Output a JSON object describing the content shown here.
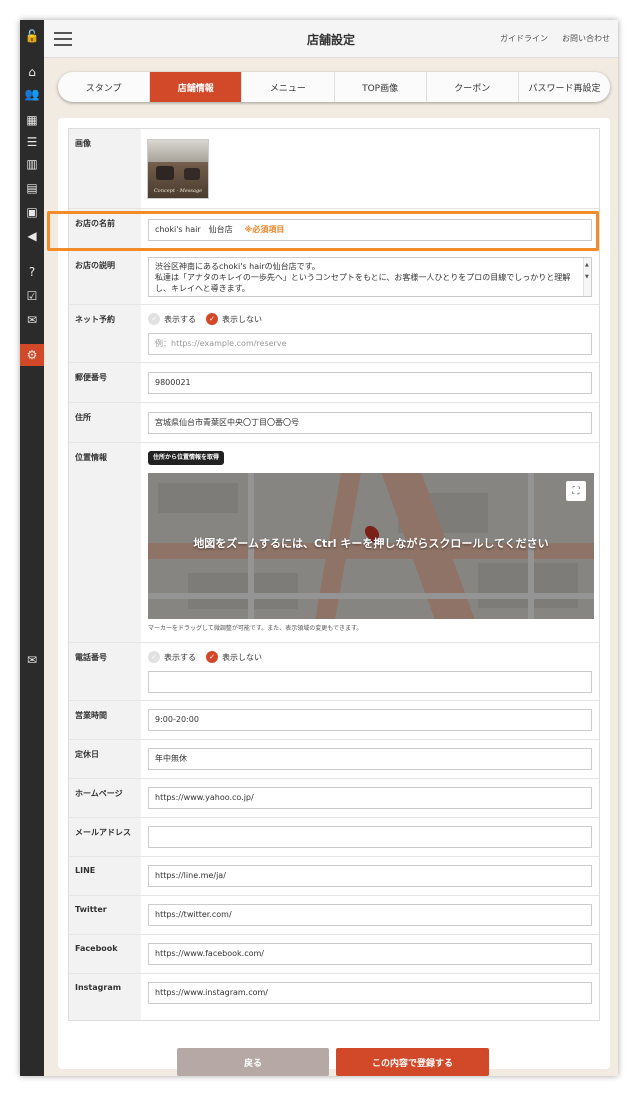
{
  "header": {
    "title": "店舗設定",
    "links": [
      "ガイドライン",
      "お問い合わせ"
    ]
  },
  "sidebar": {
    "icons": [
      "lock-icon",
      "home-icon",
      "users-icon",
      "barcode-icon",
      "database-icon",
      "chart-icon",
      "news-icon",
      "calendar-icon",
      "megaphone-icon",
      "help-icon",
      "check-icon",
      "mail-icon",
      "gear-icon",
      "mail-icon"
    ]
  },
  "tabs": [
    {
      "label": "スタンプ",
      "active": false
    },
    {
      "label": "店舗情報",
      "active": true
    },
    {
      "label": "メニュー",
      "active": false
    },
    {
      "label": "TOP画像",
      "active": false
    },
    {
      "label": "クーポン",
      "active": false
    },
    {
      "label": "パスワード再設定",
      "active": false
    }
  ],
  "form": {
    "image": {
      "label": "画像",
      "caption": "Concept ⋅ Message"
    },
    "shop_name": {
      "label": "お店の名前",
      "value": "choki's hair　仙台店",
      "required": "※必須項目"
    },
    "description": {
      "label": "お店の説明",
      "value": "渋谷区神南にあるchoki's hairの仙台店です。\n私達は「アナタのキレイの一歩先へ」というコンセプトをもとに、お客様一人ひとりをプロの目線でしっかりと理解し、キレイへと導きます。"
    },
    "net_booking": {
      "label": "ネット予約",
      "show": "表示する",
      "hide": "表示しない",
      "placeholder": "例：https://example.com/reserve"
    },
    "postal": {
      "label": "郵便番号",
      "value": "9800021"
    },
    "address": {
      "label": "住所",
      "value": "宮城県仙台市青葉区中央〇丁目〇番〇号"
    },
    "location": {
      "label": "位置情報",
      "geo_button": "住所から位置情報を取得",
      "map_message": "地図をズームするには、Ctrl キーを押しながらスクロールしてください",
      "map_note": "マーカーをドラッグして微調整が可能です。また、表示領域の変更もできます。"
    },
    "phone": {
      "label": "電話番号",
      "show": "表示する",
      "hide": "表示しない",
      "value": ""
    },
    "hours": {
      "label": "営業時間",
      "value": "9:00-20:00"
    },
    "holiday": {
      "label": "定休日",
      "value": "年中無休"
    },
    "homepage": {
      "label": "ホームページ",
      "value": "https://www.yahoo.co.jp/"
    },
    "email": {
      "label": "メールアドレス",
      "value": ""
    },
    "line": {
      "label": "LINE",
      "value": "https://line.me/ja/"
    },
    "twitter": {
      "label": "Twitter",
      "value": "https://twitter.com/"
    },
    "facebook": {
      "label": "Facebook",
      "value": "https://www.facebook.com/"
    },
    "instagram": {
      "label": "Instagram",
      "value": "https://www.instagram.com/"
    }
  },
  "buttons": {
    "back": "戻る",
    "submit": "この内容で登録する"
  },
  "colors": {
    "accent": "#d2492a",
    "highlight": "#f28c28",
    "back_button": "#b5a8a5"
  }
}
